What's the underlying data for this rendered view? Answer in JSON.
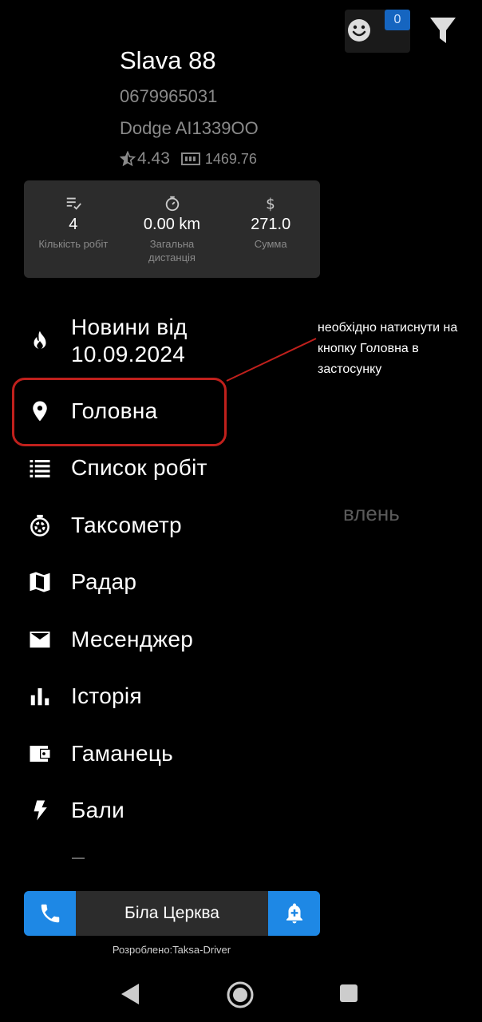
{
  "background": {
    "badge_count": "0",
    "partial_text": "влень"
  },
  "profile": {
    "name": "Slava 88",
    "phone": "0679965031",
    "car": "Dodge AI1339OO",
    "rating": "4.43",
    "balance": "1469.76"
  },
  "stats": [
    {
      "icon": "checklist-icon",
      "value": "4",
      "label": "Кількість робіт"
    },
    {
      "icon": "timer-icon",
      "value": "0.00 km",
      "label": "Загальна\nдистанція"
    },
    {
      "icon": "dollar-icon",
      "value": "271.0",
      "label": "Сумма"
    }
  ],
  "menu": {
    "news": "Новини від\n10.09.2024",
    "home": "Головна",
    "jobs": "Список робіт",
    "taximeter": "Таксометр",
    "radar": "Радар",
    "messenger": "Месенджер",
    "history": "Історія",
    "wallet": "Гаманець",
    "points": "Бали"
  },
  "annotation": {
    "text": "необхідно натиснути на кнопку Головна в застосунку",
    "color": "#c0201c"
  },
  "bottom": {
    "city": "Біла Церква",
    "credit": "Розроблено:Taksa-Driver"
  },
  "colors": {
    "accent": "#1e88e5",
    "card": "#2c2c2c",
    "muted": "#8a8a8a"
  }
}
